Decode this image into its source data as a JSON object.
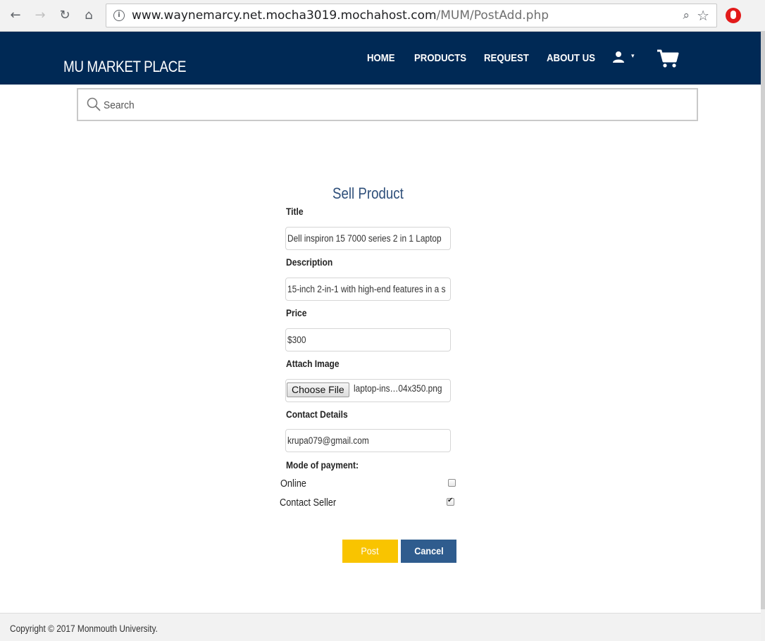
{
  "browser": {
    "url_host": "www.waynemarcy.net.mocha3019.mochahost.com",
    "url_path": "/MUM/PostAdd.php"
  },
  "header": {
    "brand": "MU MARKET PLACE",
    "nav": [
      "HOME",
      "PRODUCTS",
      "REQUEST",
      "ABOUT US"
    ]
  },
  "search": {
    "placeholder": "Search"
  },
  "form": {
    "title": "Sell Product",
    "fields": {
      "title": {
        "label": "Title",
        "value": "Dell inspiron 15 7000 series 2 in 1 Laptop"
      },
      "description": {
        "label": "Description",
        "value": "15-inch 2-in-1 with high-end features in a s"
      },
      "price": {
        "label": "Price",
        "value": "$300"
      },
      "image": {
        "label": "Attach Image",
        "button": "Choose File",
        "file_name": "laptop-ins…04x350.png"
      },
      "contact": {
        "label": "Contact Details",
        "value": "krupa079@gmail.com"
      }
    },
    "payment": {
      "label": "Mode of payment:",
      "options": [
        {
          "label": "Online",
          "checked": false
        },
        {
          "label": "Contact Seller",
          "checked": true
        }
      ]
    },
    "buttons": {
      "post": "Post",
      "cancel": "Cancel"
    }
  },
  "footer": {
    "text": "Copyright © 2017 Monmouth University."
  },
  "colors": {
    "header_bg": "#002955",
    "post_button": "#f9c400",
    "cancel_button": "#2f5c8e",
    "title_color": "#2e4f7a"
  },
  "icons": [
    "back-icon",
    "forward-icon",
    "reload-icon",
    "home-icon",
    "info-icon",
    "zoom-icon",
    "star-icon",
    "extension-icon",
    "user-icon",
    "cart-icon",
    "search-icon"
  ]
}
